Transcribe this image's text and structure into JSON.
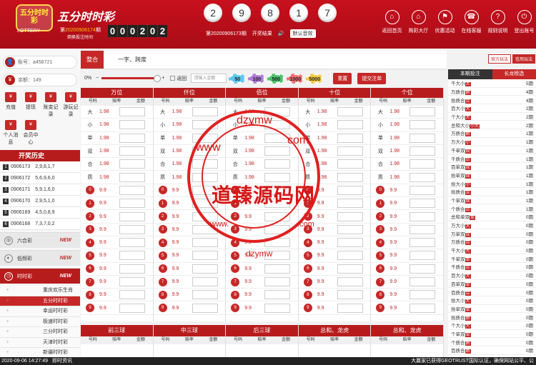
{
  "header": {
    "logo_text": "五分时时彩",
    "logo_en": "LOTTERY",
    "title": "五分时时彩",
    "issue_prefix": "第",
    "issue": "20200906174",
    "issue_suffix": "期",
    "countdown_label": "倒换投注时间",
    "countdown": [
      "0",
      "0",
      "0",
      "2",
      "0",
      "2"
    ],
    "balls": [
      "2",
      "9",
      "8",
      "1",
      "7"
    ],
    "last_issue": "第20200906173期",
    "last_label": "开奖结果",
    "sound": "默认音效",
    "nav": [
      {
        "icon": "⌂",
        "label": "返回首页",
        "name": "home-icon"
      },
      {
        "icon": "⌂",
        "label": "购彩大厅",
        "name": "hall-icon"
      },
      {
        "icon": "⚑",
        "label": "优惠活动",
        "name": "promo-icon"
      },
      {
        "icon": "☎",
        "label": "在线客服",
        "name": "service-icon"
      },
      {
        "icon": "?",
        "label": "规则说明",
        "name": "rules-icon"
      },
      {
        "icon": "⏻",
        "label": "登出账号",
        "name": "logout-icon"
      }
    ]
  },
  "account": {
    "user": "账号：a458721",
    "balance": "余额：149"
  },
  "quick": [
    "充值",
    "提现",
    "账变记录",
    "游玩记录",
    "个人消息",
    "会员中心"
  ],
  "history": {
    "title": "开奖历史",
    "rows": [
      {
        "issue": "0906173",
        "nums": "2,9,8,1,7"
      },
      {
        "issue": "0906172",
        "nums": "5,6,9,6,0"
      },
      {
        "issue": "0906171",
        "nums": "5,9,1,6,0"
      },
      {
        "issue": "0906170",
        "nums": "2,9,5,1,0"
      },
      {
        "issue": "0906169",
        "nums": "4,5,0,8,9"
      },
      {
        "issue": "0906168",
        "nums": "7,3,7,0,2"
      }
    ]
  },
  "categories": [
    {
      "label": "六合彩",
      "new": "NEW"
    },
    {
      "label": "低频彩",
      "new": "NEW"
    },
    {
      "label": "时时彩",
      "new": "NEW"
    }
  ],
  "sub_items": [
    "重庆欢乐生肖",
    "五分时时彩",
    "幸运时时彩",
    "极速时时彩",
    "三分时时彩",
    "天津时时彩",
    "新疆时时彩"
  ],
  "tabs": [
    "整合",
    "一字、跨度"
  ],
  "switch": [
    "官方玩法",
    "信用玩法"
  ],
  "controls": {
    "percent": "0%",
    "rebate": "返回",
    "amount_placeholder": "请输入金额",
    "chips": [
      "50",
      "100",
      "500",
      "1000",
      "5000"
    ],
    "reset": "重置",
    "submit": "提交注单"
  },
  "positions": [
    "万位",
    "仟位",
    "佰位",
    "十位",
    "个位"
  ],
  "col_headers": [
    "号码",
    "赔率",
    "金额"
  ],
  "bigsmall": [
    {
      "n": "大",
      "o": "1.98"
    },
    {
      "n": "小",
      "o": "1.98"
    },
    {
      "n": "单",
      "o": "1.98"
    },
    {
      "n": "双",
      "o": "1.98"
    },
    {
      "n": "合",
      "o": "1.98"
    },
    {
      "n": "质",
      "o": "1.98"
    }
  ],
  "digits": [
    "0",
    "1",
    "2",
    "3",
    "4",
    "5",
    "6",
    "7",
    "8",
    "9"
  ],
  "digit_odds": "9.9",
  "bottom_sections": [
    "前三球",
    "中三球",
    "后三球",
    "总和、龙虎",
    "总和、龙虎"
  ],
  "right": {
    "tabs": [
      "本期投注",
      "长龙榜选"
    ],
    "rows": [
      {
        "t": "千大小",
        "tag": "大",
        "v": "5期"
      },
      {
        "t": "万质合",
        "tag": "质",
        "v": "4期"
      },
      {
        "t": "拾质合",
        "tag": "合",
        "v": "4期"
      },
      {
        "t": "百大小",
        "tag": "大",
        "v": "2期"
      },
      {
        "t": "个大小",
        "tag": "大",
        "v": "2期"
      },
      {
        "t": "总和大小",
        "tag": "小大",
        "v": "2期"
      },
      {
        "t": "万质合",
        "tag": "质",
        "v": "1期"
      },
      {
        "t": "万大小",
        "tag": "小",
        "v": "1期"
      },
      {
        "t": "千单双",
        "tag": "双",
        "v": "1期"
      },
      {
        "t": "千质合",
        "tag": "合",
        "v": "1期"
      },
      {
        "t": "百单双",
        "tag": "双",
        "v": "1期"
      },
      {
        "t": "拾单双",
        "tag": "双",
        "v": "1期"
      },
      {
        "t": "拾大小",
        "tag": "小",
        "v": "1期"
      },
      {
        "t": "拾质合",
        "tag": "合",
        "v": "1期"
      },
      {
        "t": "个单双",
        "tag": "双",
        "v": "1期"
      },
      {
        "t": "个质合",
        "tag": "合",
        "v": "1期"
      },
      {
        "t": "总和单双",
        "tag": "单",
        "v": "0期"
      },
      {
        "t": "万大小",
        "tag": "大",
        "v": "0期"
      },
      {
        "t": "万单双",
        "tag": "双",
        "v": "0期"
      },
      {
        "t": "万质合",
        "tag": "合",
        "v": "0期"
      },
      {
        "t": "千大小",
        "tag": "大",
        "v": "0期"
      },
      {
        "t": "千单双",
        "tag": "单",
        "v": "0期"
      },
      {
        "t": "千质合",
        "tag": "合",
        "v": "0期"
      },
      {
        "t": "百大小",
        "tag": "大",
        "v": "0期"
      },
      {
        "t": "百单双",
        "tag": "单",
        "v": "0期"
      },
      {
        "t": "百质合",
        "tag": "合",
        "v": "0期"
      },
      {
        "t": "拾大小",
        "tag": "大",
        "v": "0期"
      },
      {
        "t": "拾单双",
        "tag": "单",
        "v": "0期"
      },
      {
        "t": "拾质合",
        "tag": "质",
        "v": "0期"
      },
      {
        "t": "个大小",
        "tag": "大",
        "v": "0期"
      },
      {
        "t": "个单双",
        "tag": "单",
        "v": "0期"
      },
      {
        "t": "个质合",
        "tag": "质",
        "v": "0期"
      },
      {
        "t": "百质合",
        "tag": "质",
        "v": "0期"
      }
    ]
  },
  "footer": {
    "time": "2020-09-06 14:27:49",
    "label": "即时资讯",
    "right": "大赢家已获得GEOTRUST国际认证，确保网站公平、公"
  },
  "watermark": {
    "main": "道臻源码网",
    "top": "dzymw",
    "bottom": "dzymw",
    "left": "www",
    "right": "com",
    "mid_left": "www.",
    "mid_right": ".com"
  }
}
